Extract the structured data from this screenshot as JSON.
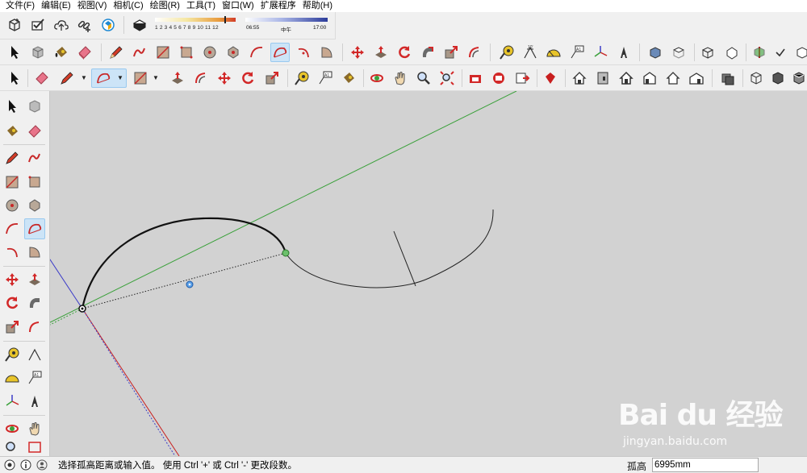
{
  "menu": [
    "文件(F)",
    "编辑(E)",
    "视图(V)",
    "相机(C)",
    "绘图(R)",
    "工具(T)",
    "窗口(W)",
    "扩展程序",
    "帮助(H)"
  ],
  "shadow": {
    "time_ticks": "1 2 3 4 5 6 7 8 9 10 11 12",
    "date_start": "06:55",
    "date_mid": "中午",
    "date_end": "17:00"
  },
  "viewport": {
    "background": "#d2d2d2",
    "green_axis_color": "#3aa03a",
    "red_axis_color": "#c81e1e",
    "blue_axis_color": "#3c3cc8"
  },
  "status": {
    "text": "选择孤高距离或输入值。 使用 Ctrl '+' 或 Ctrl '-' 更改段数。",
    "measure_label": "孤高",
    "measure_value": "6995mm"
  },
  "watermark": {
    "logo": "Bai du 经验",
    "url": "jingyan.baidu.com"
  }
}
